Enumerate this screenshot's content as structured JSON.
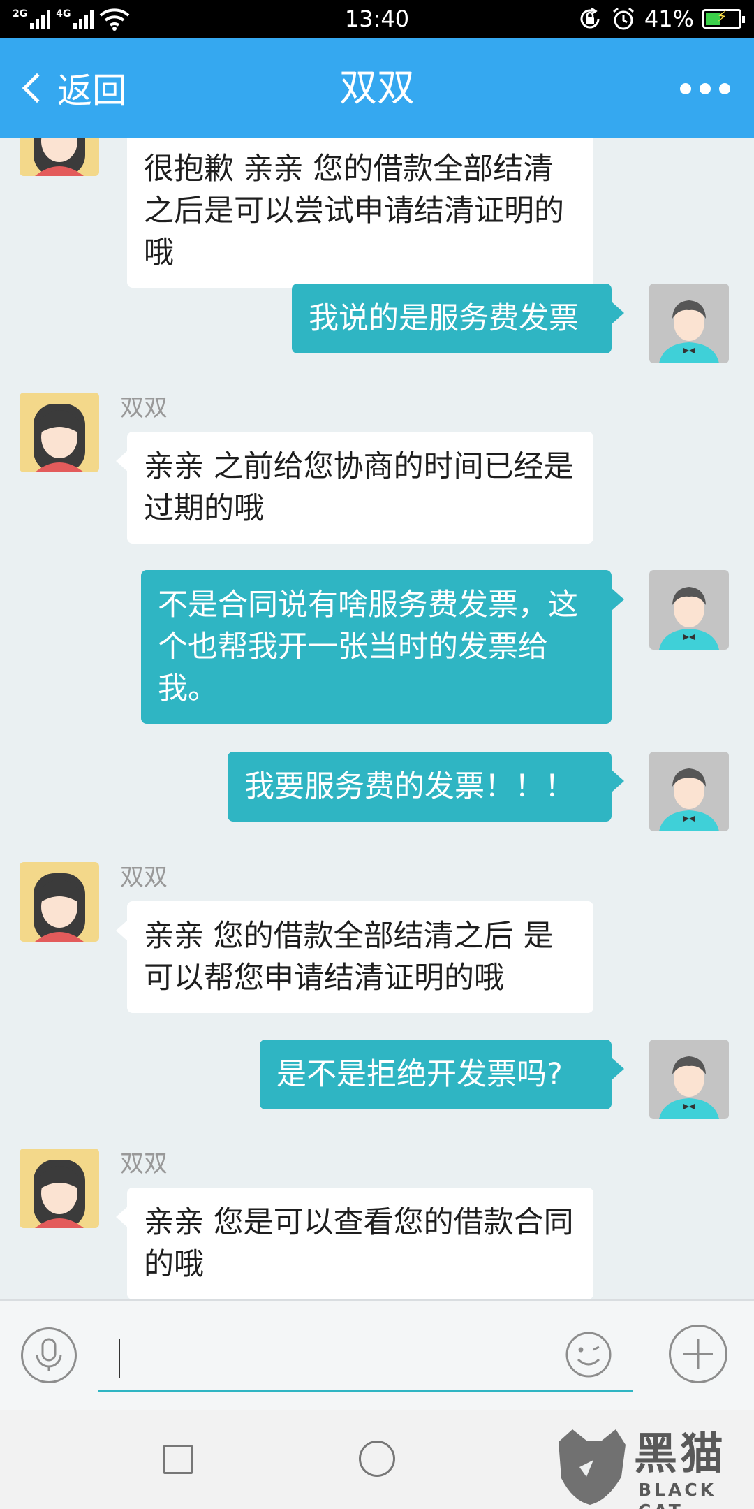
{
  "status_bar": {
    "sim1_label": "2G",
    "sim2_label": "4G",
    "time": "13:40",
    "battery_level": 0.41,
    "battery_text": "41%"
  },
  "header": {
    "back_label": "返回",
    "title": "双双",
    "more_icon": "more-dots-icon"
  },
  "messages": [
    {
      "side": "in",
      "sender": "",
      "text": "很抱歉 亲亲 您的借款全部结清之后是可以尝试申请结清证明的哦"
    },
    {
      "side": "out",
      "text": "我说的是服务费发票"
    },
    {
      "side": "in",
      "sender": "双双",
      "text": "亲亲 之前给您协商的时间已经是过期的哦"
    },
    {
      "side": "out",
      "text": "不是合同说有啥服务费发票，这个也帮我开一张当时的发票给我。"
    },
    {
      "side": "out",
      "text": "我要服务费的发票！！！"
    },
    {
      "side": "in",
      "sender": "双双",
      "text": "亲亲 您的借款全部结清之后 是可以帮您申请结清证明的哦"
    },
    {
      "side": "out",
      "text": "是不是拒绝开发票吗?"
    },
    {
      "side": "in",
      "sender": "双双",
      "text": "亲亲 您是可以查看您的借款合同的哦"
    }
  ],
  "input": {
    "value": "",
    "voice_icon": "microphone-icon",
    "emoji_icon": "emoji-icon",
    "plus_icon": "plus-icon"
  },
  "watermark": {
    "brand": "黑猫",
    "brand_en": "BLACK CAT"
  },
  "colors": {
    "header_bg": "#35a8f0",
    "outgoing_bubble": "#2fb5c3",
    "incoming_bubble": "#ffffff",
    "chat_bg": "#eaf0f2"
  }
}
